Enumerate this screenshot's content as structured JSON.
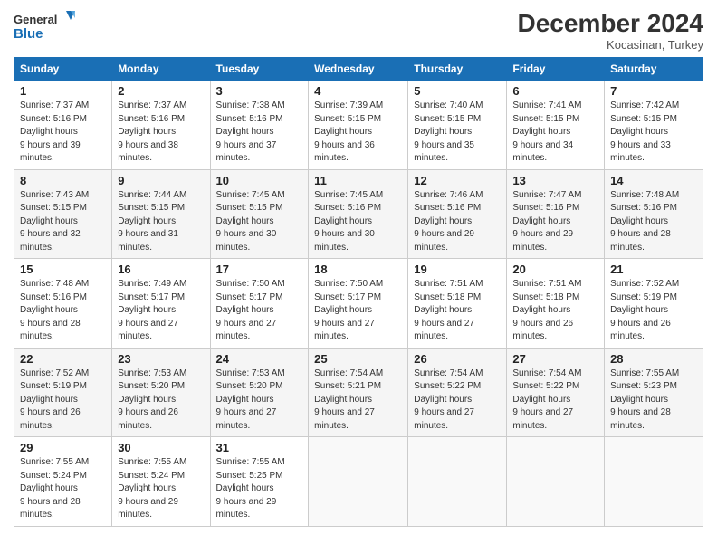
{
  "logo": {
    "line1": "General",
    "line2": "Blue"
  },
  "title": "December 2024",
  "subtitle": "Kocasinan, Turkey",
  "days_of_week": [
    "Sunday",
    "Monday",
    "Tuesday",
    "Wednesday",
    "Thursday",
    "Friday",
    "Saturday"
  ],
  "weeks": [
    [
      {
        "day": "1",
        "sunrise": "7:37 AM",
        "sunset": "5:16 PM",
        "daylight": "9 hours and 39 minutes."
      },
      {
        "day": "2",
        "sunrise": "7:37 AM",
        "sunset": "5:16 PM",
        "daylight": "9 hours and 38 minutes."
      },
      {
        "day": "3",
        "sunrise": "7:38 AM",
        "sunset": "5:16 PM",
        "daylight": "9 hours and 37 minutes."
      },
      {
        "day": "4",
        "sunrise": "7:39 AM",
        "sunset": "5:15 PM",
        "daylight": "9 hours and 36 minutes."
      },
      {
        "day": "5",
        "sunrise": "7:40 AM",
        "sunset": "5:15 PM",
        "daylight": "9 hours and 35 minutes."
      },
      {
        "day": "6",
        "sunrise": "7:41 AM",
        "sunset": "5:15 PM",
        "daylight": "9 hours and 34 minutes."
      },
      {
        "day": "7",
        "sunrise": "7:42 AM",
        "sunset": "5:15 PM",
        "daylight": "9 hours and 33 minutes."
      }
    ],
    [
      {
        "day": "8",
        "sunrise": "7:43 AM",
        "sunset": "5:15 PM",
        "daylight": "9 hours and 32 minutes."
      },
      {
        "day": "9",
        "sunrise": "7:44 AM",
        "sunset": "5:15 PM",
        "daylight": "9 hours and 31 minutes."
      },
      {
        "day": "10",
        "sunrise": "7:45 AM",
        "sunset": "5:15 PM",
        "daylight": "9 hours and 30 minutes."
      },
      {
        "day": "11",
        "sunrise": "7:45 AM",
        "sunset": "5:16 PM",
        "daylight": "9 hours and 30 minutes."
      },
      {
        "day": "12",
        "sunrise": "7:46 AM",
        "sunset": "5:16 PM",
        "daylight": "9 hours and 29 minutes."
      },
      {
        "day": "13",
        "sunrise": "7:47 AM",
        "sunset": "5:16 PM",
        "daylight": "9 hours and 29 minutes."
      },
      {
        "day": "14",
        "sunrise": "7:48 AM",
        "sunset": "5:16 PM",
        "daylight": "9 hours and 28 minutes."
      }
    ],
    [
      {
        "day": "15",
        "sunrise": "7:48 AM",
        "sunset": "5:16 PM",
        "daylight": "9 hours and 28 minutes."
      },
      {
        "day": "16",
        "sunrise": "7:49 AM",
        "sunset": "5:17 PM",
        "daylight": "9 hours and 27 minutes."
      },
      {
        "day": "17",
        "sunrise": "7:50 AM",
        "sunset": "5:17 PM",
        "daylight": "9 hours and 27 minutes."
      },
      {
        "day": "18",
        "sunrise": "7:50 AM",
        "sunset": "5:17 PM",
        "daylight": "9 hours and 27 minutes."
      },
      {
        "day": "19",
        "sunrise": "7:51 AM",
        "sunset": "5:18 PM",
        "daylight": "9 hours and 27 minutes."
      },
      {
        "day": "20",
        "sunrise": "7:51 AM",
        "sunset": "5:18 PM",
        "daylight": "9 hours and 26 minutes."
      },
      {
        "day": "21",
        "sunrise": "7:52 AM",
        "sunset": "5:19 PM",
        "daylight": "9 hours and 26 minutes."
      }
    ],
    [
      {
        "day": "22",
        "sunrise": "7:52 AM",
        "sunset": "5:19 PM",
        "daylight": "9 hours and 26 minutes."
      },
      {
        "day": "23",
        "sunrise": "7:53 AM",
        "sunset": "5:20 PM",
        "daylight": "9 hours and 26 minutes."
      },
      {
        "day": "24",
        "sunrise": "7:53 AM",
        "sunset": "5:20 PM",
        "daylight": "9 hours and 27 minutes."
      },
      {
        "day": "25",
        "sunrise": "7:54 AM",
        "sunset": "5:21 PM",
        "daylight": "9 hours and 27 minutes."
      },
      {
        "day": "26",
        "sunrise": "7:54 AM",
        "sunset": "5:22 PM",
        "daylight": "9 hours and 27 minutes."
      },
      {
        "day": "27",
        "sunrise": "7:54 AM",
        "sunset": "5:22 PM",
        "daylight": "9 hours and 27 minutes."
      },
      {
        "day": "28",
        "sunrise": "7:55 AM",
        "sunset": "5:23 PM",
        "daylight": "9 hours and 28 minutes."
      }
    ],
    [
      {
        "day": "29",
        "sunrise": "7:55 AM",
        "sunset": "5:24 PM",
        "daylight": "9 hours and 28 minutes."
      },
      {
        "day": "30",
        "sunrise": "7:55 AM",
        "sunset": "5:24 PM",
        "daylight": "9 hours and 29 minutes."
      },
      {
        "day": "31",
        "sunrise": "7:55 AM",
        "sunset": "5:25 PM",
        "daylight": "9 hours and 29 minutes."
      },
      null,
      null,
      null,
      null
    ]
  ],
  "labels": {
    "sunrise": "Sunrise:",
    "sunset": "Sunset:",
    "daylight": "Daylight hours"
  }
}
